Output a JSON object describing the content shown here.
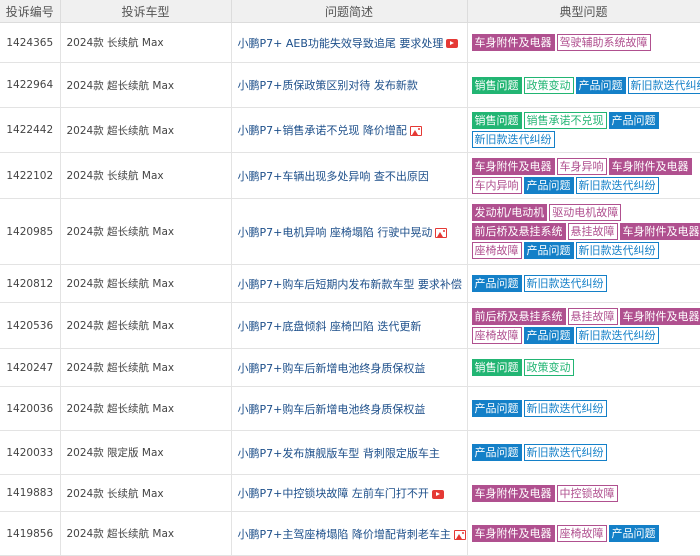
{
  "colors": {
    "car_accessories": "#b0508f",
    "sales": "#22b573",
    "product": "#1480c8"
  },
  "columns": [
    "投诉编号",
    "投诉车型",
    "问题简述",
    "典型问题"
  ],
  "rows": [
    {
      "id": "1424365",
      "model": "2024款 长续航 Max",
      "desc": "小鹏P7+ AEB功能失效导致追尾 要求处理",
      "icon": "video-icon",
      "tags": [
        [
          {
            "t": "车身附件及电器",
            "k": "car_accessories",
            "s": "fill"
          },
          {
            "t": "驾驶辅助系统故障",
            "k": "car_accessories",
            "s": "outline"
          }
        ]
      ]
    },
    {
      "id": "1422964",
      "model": "2024款 超长续航 Max",
      "desc": "小鹏P7+质保政策区别对待 发布新款",
      "icon": "",
      "tags": [
        [
          {
            "t": "销售问题",
            "k": "sales",
            "s": "fill"
          },
          {
            "t": "政策变动",
            "k": "sales",
            "s": "outline"
          },
          {
            "t": "产品问题",
            "k": "product",
            "s": "fill"
          },
          {
            "t": "新旧款迭代纠纷",
            "k": "product",
            "s": "outline"
          }
        ]
      ]
    },
    {
      "id": "1422442",
      "model": "2024款 超长续航 Max",
      "desc": "小鹏P7+销售承诺不兑现 降价增配",
      "icon": "image-icon",
      "tags": [
        [
          {
            "t": "销售问题",
            "k": "sales",
            "s": "fill"
          },
          {
            "t": "销售承诺不兑现",
            "k": "sales",
            "s": "outline"
          },
          {
            "t": "产品问题",
            "k": "product",
            "s": "fill"
          }
        ],
        [
          {
            "t": "新旧款迭代纠纷",
            "k": "product",
            "s": "outline"
          }
        ]
      ]
    },
    {
      "id": "1422102",
      "model": "2024款 长续航 Max",
      "desc": "小鹏P7+车辆出现多处异响 查不出原因",
      "icon": "",
      "tags": [
        [
          {
            "t": "车身附件及电器",
            "k": "car_accessories",
            "s": "fill"
          },
          {
            "t": "车身异响",
            "k": "car_accessories",
            "s": "outline"
          },
          {
            "t": "车身附件及电器",
            "k": "car_accessories",
            "s": "fill"
          }
        ],
        [
          {
            "t": "车内异响",
            "k": "car_accessories",
            "s": "outline"
          },
          {
            "t": "产品问题",
            "k": "product",
            "s": "fill"
          },
          {
            "t": "新旧款迭代纠纷",
            "k": "product",
            "s": "outline"
          }
        ]
      ]
    },
    {
      "id": "1420985",
      "model": "2024款 超长续航 Max",
      "desc": "小鹏P7+电机异响 座椅塌陷 行驶中晃动",
      "icon": "image-icon",
      "tags": [
        [
          {
            "t": "发动机/电动机",
            "k": "car_accessories",
            "s": "fill"
          },
          {
            "t": "驱动电机故障",
            "k": "car_accessories",
            "s": "outline"
          }
        ],
        [
          {
            "t": "前后桥及悬挂系统",
            "k": "car_accessories",
            "s": "fill"
          },
          {
            "t": "悬挂故障",
            "k": "car_accessories",
            "s": "outline"
          },
          {
            "t": "车身附件及电器",
            "k": "car_accessories",
            "s": "fill"
          }
        ],
        [
          {
            "t": "座椅故障",
            "k": "car_accessories",
            "s": "outline"
          },
          {
            "t": "产品问题",
            "k": "product",
            "s": "fill"
          },
          {
            "t": "新旧款迭代纠纷",
            "k": "product",
            "s": "outline"
          }
        ]
      ]
    },
    {
      "id": "1420812",
      "model": "2024款 超长续航 Max",
      "desc": "小鹏P7+购车后短期内发布新款车型 要求补偿",
      "icon": "",
      "tags": [
        [
          {
            "t": "产品问题",
            "k": "product",
            "s": "fill"
          },
          {
            "t": "新旧款迭代纠纷",
            "k": "product",
            "s": "outline"
          }
        ]
      ]
    },
    {
      "id": "1420536",
      "model": "2024款 超长续航 Max",
      "desc": "小鹏P7+底盘倾斜 座椅凹陷 迭代更新",
      "icon": "",
      "tags": [
        [
          {
            "t": "前后桥及悬挂系统",
            "k": "car_accessories",
            "s": "fill"
          },
          {
            "t": "悬挂故障",
            "k": "car_accessories",
            "s": "outline"
          },
          {
            "t": "车身附件及电器",
            "k": "car_accessories",
            "s": "fill"
          }
        ],
        [
          {
            "t": "座椅故障",
            "k": "car_accessories",
            "s": "outline"
          },
          {
            "t": "产品问题",
            "k": "product",
            "s": "fill"
          },
          {
            "t": "新旧款迭代纠纷",
            "k": "product",
            "s": "outline"
          }
        ]
      ]
    },
    {
      "id": "1420247",
      "model": "2024款 超长续航 Max",
      "desc": "小鹏P7+购车后新增电池终身质保权益",
      "icon": "",
      "tags": [
        [
          {
            "t": "销售问题",
            "k": "sales",
            "s": "fill"
          },
          {
            "t": "政策变动",
            "k": "sales",
            "s": "outline"
          }
        ]
      ]
    },
    {
      "id": "1420036",
      "model": "2024款 超长续航 Max",
      "desc": "小鹏P7+购车后新增电池终身质保权益",
      "icon": "",
      "tags": [
        [
          {
            "t": "产品问题",
            "k": "product",
            "s": "fill"
          },
          {
            "t": "新旧款迭代纠纷",
            "k": "product",
            "s": "outline"
          }
        ]
      ]
    },
    {
      "id": "1420033",
      "model": "2024款 限定版 Max",
      "desc": "小鹏P7+发布旗舰版车型 背刺限定版车主",
      "icon": "",
      "tags": [
        [
          {
            "t": "产品问题",
            "k": "product",
            "s": "fill"
          },
          {
            "t": "新旧款迭代纠纷",
            "k": "product",
            "s": "outline"
          }
        ]
      ]
    },
    {
      "id": "1419883",
      "model": "2024款 长续航 Max",
      "desc": "小鹏P7+中控锁块故障 左前车门打不开",
      "icon": "video-icon",
      "tags": [
        [
          {
            "t": "车身附件及电器",
            "k": "car_accessories",
            "s": "fill"
          },
          {
            "t": "中控锁故障",
            "k": "car_accessories",
            "s": "outline"
          }
        ]
      ]
    },
    {
      "id": "1419856",
      "model": "2024款 超长续航 Max",
      "desc": "小鹏P7+主驾座椅塌陷 降价增配背刺老车主",
      "icon": "image-icon",
      "tags": [
        [
          {
            "t": "车身附件及电器",
            "k": "car_accessories",
            "s": "fill"
          },
          {
            "t": "座椅故障",
            "k": "car_accessories",
            "s": "outline"
          },
          {
            "t": "产品问题",
            "k": "product",
            "s": "fill"
          }
        ]
      ]
    }
  ]
}
